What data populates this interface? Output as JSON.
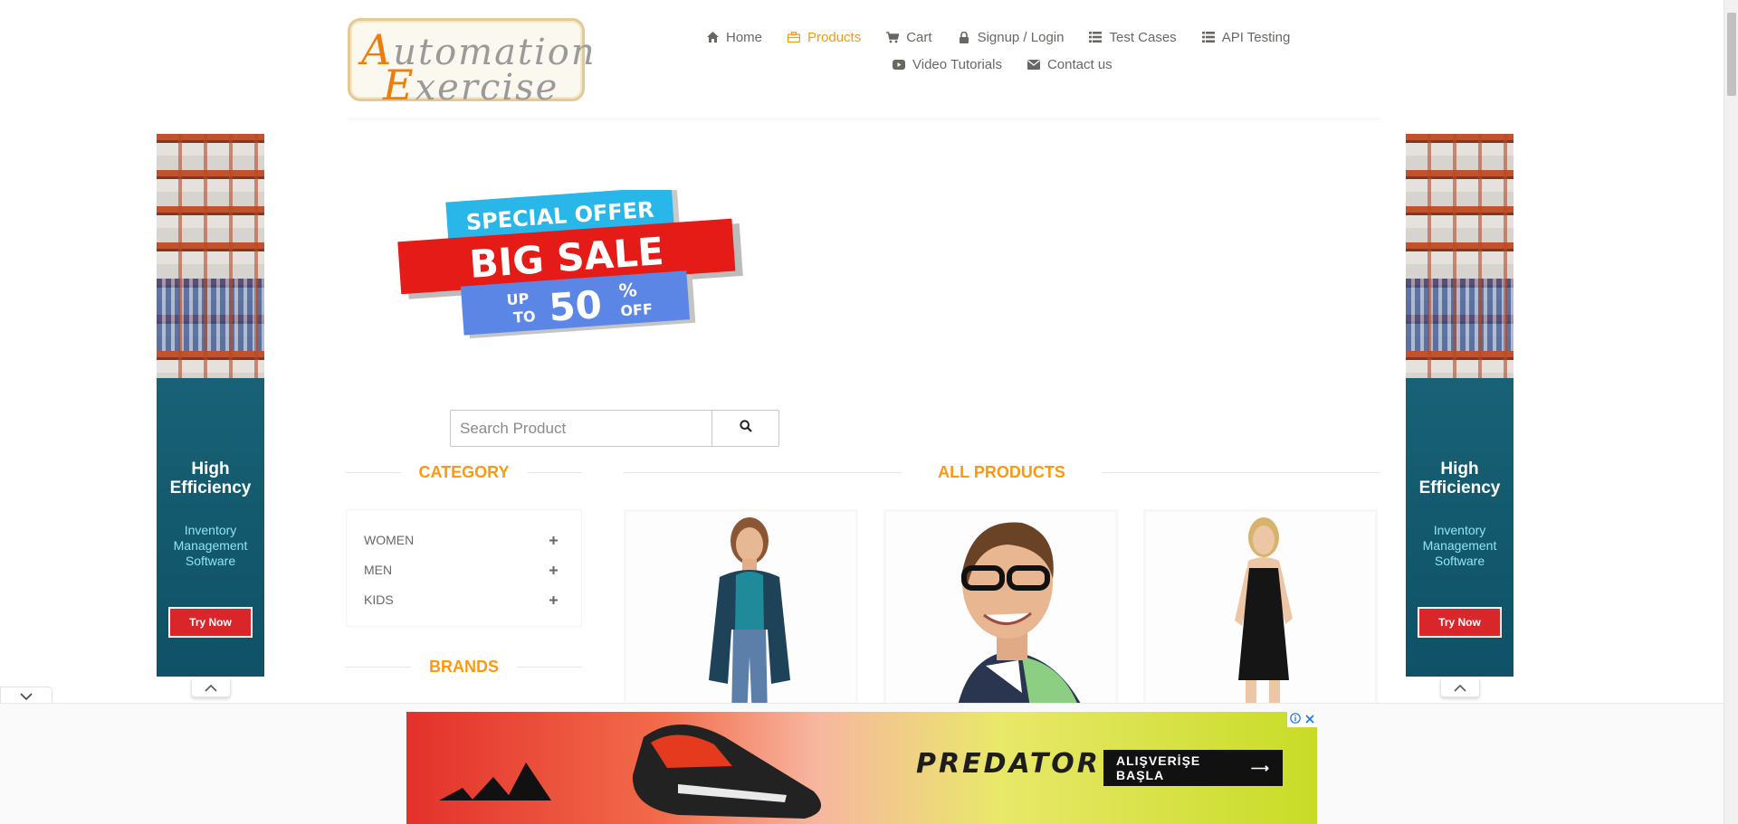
{
  "logo": {
    "line1": "Automation",
    "line2": "Exercise",
    "alt": "Automation Exercise"
  },
  "nav": {
    "items": [
      {
        "label": "Home",
        "icon": "home-icon",
        "active": false
      },
      {
        "label": "Products",
        "icon": "briefcase-icon",
        "active": true
      },
      {
        "label": "Cart",
        "icon": "cart-icon",
        "active": false
      },
      {
        "label": "Signup / Login",
        "icon": "lock-icon",
        "active": false
      },
      {
        "label": "Test Cases",
        "icon": "list-icon",
        "active": false
      },
      {
        "label": "API Testing",
        "icon": "list-icon",
        "active": false
      },
      {
        "label": "Video Tutorials",
        "icon": "youtube-icon",
        "active": false
      },
      {
        "label": "Contact us",
        "icon": "envelope-icon",
        "active": false
      }
    ],
    "active_color": "#f39c12"
  },
  "sale_banner": {
    "line1": "SPECIAL OFFER",
    "line2": "BIG SALE",
    "up": "UP",
    "to": "TO",
    "percent": "50",
    "pct_sign": "%",
    "off": "OFF"
  },
  "search": {
    "placeholder": "Search Product"
  },
  "category": {
    "title": "CATEGORY",
    "items": [
      {
        "label": "WOMEN"
      },
      {
        "label": "MEN"
      },
      {
        "label": "KIDS"
      }
    ]
  },
  "brands": {
    "title": "BRANDS"
  },
  "products": {
    "title": "ALL PRODUCTS"
  },
  "side_ads": {
    "headline_line1": "High",
    "headline_line2": "Efficiency",
    "sub_line1": "Inventory",
    "sub_line2": "Management",
    "sub_line3": "Software",
    "button": "Try Now"
  },
  "bottom_ad": {
    "brand_text": "PREDATOR",
    "button": "ALIŞVERİŞE BAŞLA",
    "arrow": "⟶"
  },
  "colors": {
    "accent": "#fe980f",
    "ad_red": "#d9262b"
  }
}
